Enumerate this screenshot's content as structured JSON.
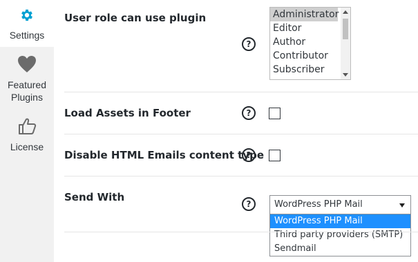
{
  "sidebar": {
    "items": [
      {
        "label": "Settings",
        "icon": "gear-icon",
        "color": "#00a0d2",
        "active": true
      },
      {
        "label": "Featured Plugins",
        "line1": "Featured",
        "line2": "Plugins",
        "icon": "heart-icon"
      },
      {
        "label": "License",
        "icon": "thumbs-up-icon"
      }
    ]
  },
  "rows": {
    "user_role": {
      "label": "User role can use plugin",
      "options": [
        "Administrator",
        "Editor",
        "Author",
        "Contributor",
        "Subscriber"
      ],
      "selected": "Administrator"
    },
    "load_assets": {
      "label": "Load Assets in Footer",
      "checked": false
    },
    "disable_html": {
      "label": "Disable HTML Emails content type",
      "checked": false
    },
    "send_with": {
      "label": "Send With",
      "value": "WordPress PHP Mail",
      "options": [
        "WordPress PHP Mail",
        "Third party providers (SMTP)",
        "Sendmail"
      ],
      "highlighted": "WordPress PHP Mail"
    }
  },
  "help_glyph": "?"
}
